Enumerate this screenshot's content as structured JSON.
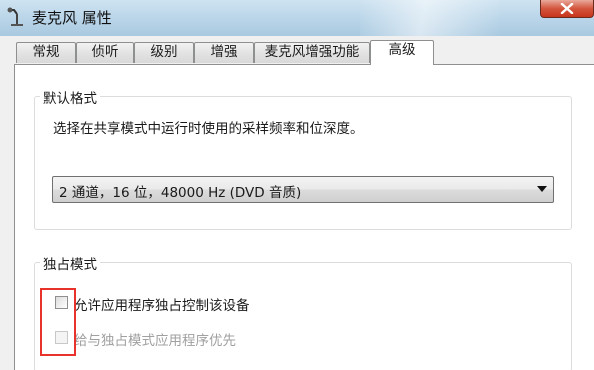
{
  "window": {
    "title": "麦克风 属性",
    "app_icon": "microphone-icon",
    "close_icon": "close-icon"
  },
  "tabs": [
    {
      "label": "常规",
      "active": false
    },
    {
      "label": "侦听",
      "active": false
    },
    {
      "label": "级别",
      "active": false
    },
    {
      "label": "增强",
      "active": false
    },
    {
      "label": "麦克风增强功能",
      "active": false
    },
    {
      "label": "高级",
      "active": true
    }
  ],
  "default_format": {
    "group_title": "默认格式",
    "description": "选择在共享模式中运行时使用的采样频率和位深度。",
    "selected": "2 通道，16 位，48000 Hz (DVD 音质)"
  },
  "exclusive_mode": {
    "group_title": "独占模式",
    "allow_exclusive": {
      "label": "允许应用程序独占控制该设备",
      "checked": false,
      "enabled": true
    },
    "exclusive_priority": {
      "label": "给与独占模式应用程序优先",
      "checked": false,
      "enabled": false
    }
  },
  "colors": {
    "highlight": "#e8332a",
    "titlebar": "#bcd7ea"
  }
}
